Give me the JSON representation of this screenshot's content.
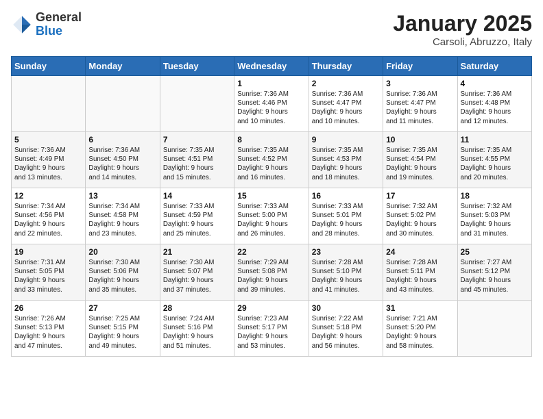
{
  "header": {
    "logo_line1": "General",
    "logo_line2": "Blue",
    "title": "January 2025",
    "subtitle": "Carsoli, Abruzzo, Italy"
  },
  "days_of_week": [
    "Sunday",
    "Monday",
    "Tuesday",
    "Wednesday",
    "Thursday",
    "Friday",
    "Saturday"
  ],
  "weeks": [
    [
      {
        "day": "",
        "info": ""
      },
      {
        "day": "",
        "info": ""
      },
      {
        "day": "",
        "info": ""
      },
      {
        "day": "1",
        "info": "Sunrise: 7:36 AM\nSunset: 4:46 PM\nDaylight: 9 hours\nand 10 minutes."
      },
      {
        "day": "2",
        "info": "Sunrise: 7:36 AM\nSunset: 4:47 PM\nDaylight: 9 hours\nand 10 minutes."
      },
      {
        "day": "3",
        "info": "Sunrise: 7:36 AM\nSunset: 4:47 PM\nDaylight: 9 hours\nand 11 minutes."
      },
      {
        "day": "4",
        "info": "Sunrise: 7:36 AM\nSunset: 4:48 PM\nDaylight: 9 hours\nand 12 minutes."
      }
    ],
    [
      {
        "day": "5",
        "info": "Sunrise: 7:36 AM\nSunset: 4:49 PM\nDaylight: 9 hours\nand 13 minutes."
      },
      {
        "day": "6",
        "info": "Sunrise: 7:36 AM\nSunset: 4:50 PM\nDaylight: 9 hours\nand 14 minutes."
      },
      {
        "day": "7",
        "info": "Sunrise: 7:35 AM\nSunset: 4:51 PM\nDaylight: 9 hours\nand 15 minutes."
      },
      {
        "day": "8",
        "info": "Sunrise: 7:35 AM\nSunset: 4:52 PM\nDaylight: 9 hours\nand 16 minutes."
      },
      {
        "day": "9",
        "info": "Sunrise: 7:35 AM\nSunset: 4:53 PM\nDaylight: 9 hours\nand 18 minutes."
      },
      {
        "day": "10",
        "info": "Sunrise: 7:35 AM\nSunset: 4:54 PM\nDaylight: 9 hours\nand 19 minutes."
      },
      {
        "day": "11",
        "info": "Sunrise: 7:35 AM\nSunset: 4:55 PM\nDaylight: 9 hours\nand 20 minutes."
      }
    ],
    [
      {
        "day": "12",
        "info": "Sunrise: 7:34 AM\nSunset: 4:56 PM\nDaylight: 9 hours\nand 22 minutes."
      },
      {
        "day": "13",
        "info": "Sunrise: 7:34 AM\nSunset: 4:58 PM\nDaylight: 9 hours\nand 23 minutes."
      },
      {
        "day": "14",
        "info": "Sunrise: 7:33 AM\nSunset: 4:59 PM\nDaylight: 9 hours\nand 25 minutes."
      },
      {
        "day": "15",
        "info": "Sunrise: 7:33 AM\nSunset: 5:00 PM\nDaylight: 9 hours\nand 26 minutes."
      },
      {
        "day": "16",
        "info": "Sunrise: 7:33 AM\nSunset: 5:01 PM\nDaylight: 9 hours\nand 28 minutes."
      },
      {
        "day": "17",
        "info": "Sunrise: 7:32 AM\nSunset: 5:02 PM\nDaylight: 9 hours\nand 30 minutes."
      },
      {
        "day": "18",
        "info": "Sunrise: 7:32 AM\nSunset: 5:03 PM\nDaylight: 9 hours\nand 31 minutes."
      }
    ],
    [
      {
        "day": "19",
        "info": "Sunrise: 7:31 AM\nSunset: 5:05 PM\nDaylight: 9 hours\nand 33 minutes."
      },
      {
        "day": "20",
        "info": "Sunrise: 7:30 AM\nSunset: 5:06 PM\nDaylight: 9 hours\nand 35 minutes."
      },
      {
        "day": "21",
        "info": "Sunrise: 7:30 AM\nSunset: 5:07 PM\nDaylight: 9 hours\nand 37 minutes."
      },
      {
        "day": "22",
        "info": "Sunrise: 7:29 AM\nSunset: 5:08 PM\nDaylight: 9 hours\nand 39 minutes."
      },
      {
        "day": "23",
        "info": "Sunrise: 7:28 AM\nSunset: 5:10 PM\nDaylight: 9 hours\nand 41 minutes."
      },
      {
        "day": "24",
        "info": "Sunrise: 7:28 AM\nSunset: 5:11 PM\nDaylight: 9 hours\nand 43 minutes."
      },
      {
        "day": "25",
        "info": "Sunrise: 7:27 AM\nSunset: 5:12 PM\nDaylight: 9 hours\nand 45 minutes."
      }
    ],
    [
      {
        "day": "26",
        "info": "Sunrise: 7:26 AM\nSunset: 5:13 PM\nDaylight: 9 hours\nand 47 minutes."
      },
      {
        "day": "27",
        "info": "Sunrise: 7:25 AM\nSunset: 5:15 PM\nDaylight: 9 hours\nand 49 minutes."
      },
      {
        "day": "28",
        "info": "Sunrise: 7:24 AM\nSunset: 5:16 PM\nDaylight: 9 hours\nand 51 minutes."
      },
      {
        "day": "29",
        "info": "Sunrise: 7:23 AM\nSunset: 5:17 PM\nDaylight: 9 hours\nand 53 minutes."
      },
      {
        "day": "30",
        "info": "Sunrise: 7:22 AM\nSunset: 5:18 PM\nDaylight: 9 hours\nand 56 minutes."
      },
      {
        "day": "31",
        "info": "Sunrise: 7:21 AM\nSunset: 5:20 PM\nDaylight: 9 hours\nand 58 minutes."
      },
      {
        "day": "",
        "info": ""
      }
    ]
  ]
}
